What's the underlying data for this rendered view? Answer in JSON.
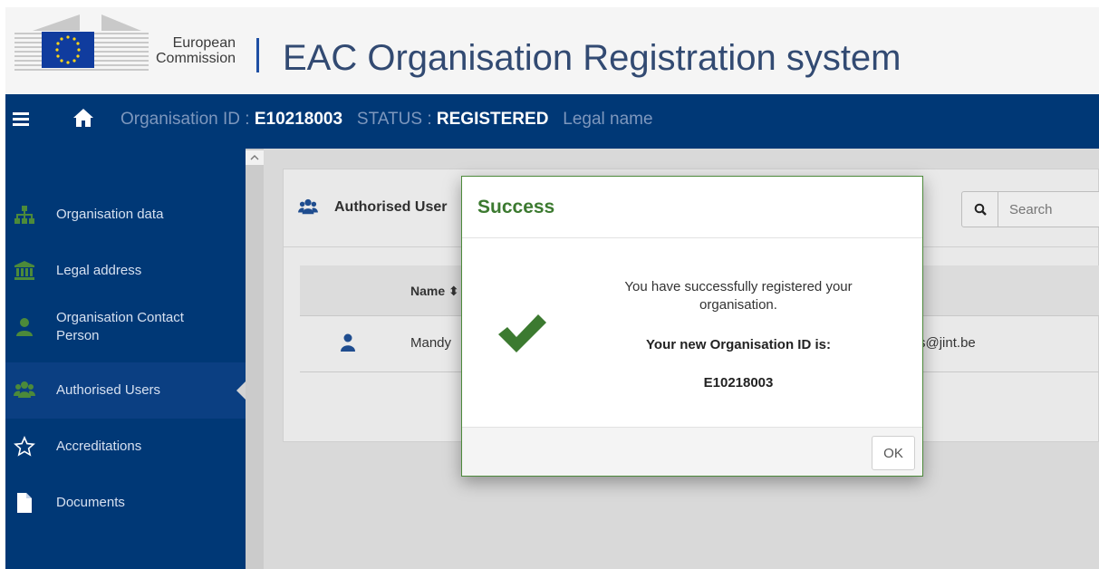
{
  "brand": {
    "ec_line1": "European",
    "ec_line2": "Commission",
    "app_title": "EAC Organisation Registration system"
  },
  "topbar": {
    "menu_icon": "hamburger-icon",
    "home_icon": "home-icon",
    "org_id_label": "Organisation ID :",
    "org_id_value": "E10218003",
    "status_label": "STATUS :",
    "status_value": "REGISTERED",
    "legal_name_label": "Legal name"
  },
  "sidebar": {
    "items": [
      {
        "label": "Organisation data",
        "icon": "sitemap-icon",
        "active": false
      },
      {
        "label": "Legal address",
        "icon": "bank-icon",
        "active": false
      },
      {
        "label": "Organisation Contact Person",
        "icon": "user-icon",
        "active": false
      },
      {
        "label": "Authorised Users",
        "icon": "users-icon",
        "active": true
      },
      {
        "label": "Accreditations",
        "icon": "star-icon",
        "active": false
      },
      {
        "label": "Documents",
        "icon": "file-icon",
        "active": false
      }
    ]
  },
  "panel": {
    "title": "Authorised User",
    "search_placeholder": "Search",
    "column_name": "Name",
    "rows": [
      {
        "name": "Mandy",
        "email_fragment": "rs@jint.be"
      }
    ]
  },
  "modal": {
    "title": "Success",
    "message": "You have successfully registered your organisation.",
    "id_label": "Your new Organisation ID is:",
    "id_value": "E10218003",
    "ok_label": "OK"
  },
  "colors": {
    "header_blue": "#003876",
    "success_green": "#3c7a30",
    "title_blue": "#324a72"
  }
}
